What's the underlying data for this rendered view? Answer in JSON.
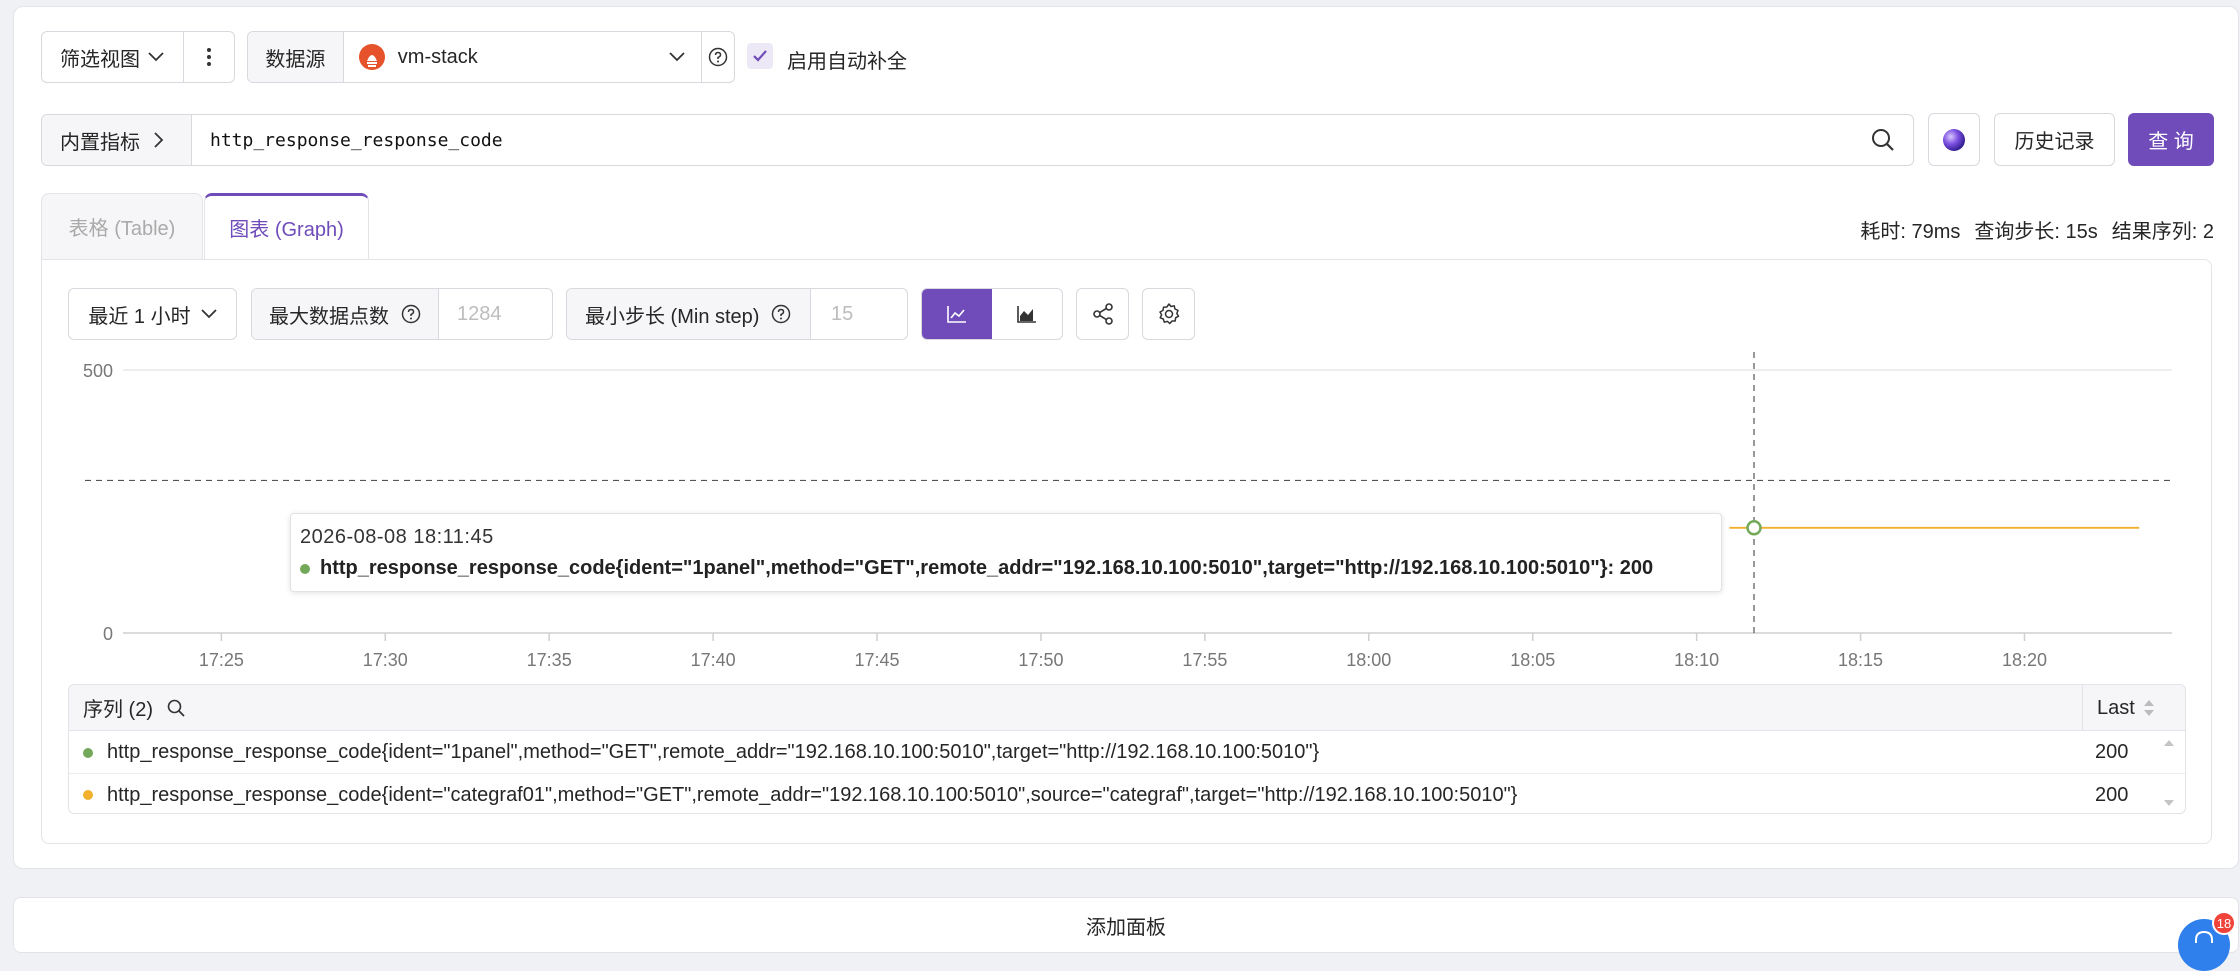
{
  "toolbar": {
    "filter_view_label": "筛选视图",
    "datasource_label": "数据源",
    "datasource_value": "vm-stack",
    "autocomplete_label": "启用自动补全",
    "autocomplete_checked": true
  },
  "query": {
    "builtin_metrics_label": "内置指标",
    "expression": "http_response_response_code",
    "history_label": "历史记录",
    "submit_label": "查 询"
  },
  "tabs": [
    {
      "label": "表格 (Table)",
      "active": false
    },
    {
      "label": "图表 (Graph)",
      "active": true
    }
  ],
  "stats": {
    "duration": "耗时: 79ms",
    "step": "查询步长: 15s",
    "series_count": "结果序列: 2"
  },
  "graph_controls": {
    "time_range": "最近 1 小时",
    "max_points_label": "最大数据点数",
    "max_points_placeholder": "1284",
    "min_step_label": "最小步长 (Min step)",
    "min_step_placeholder": "15"
  },
  "colors": {
    "accent": "#6f4cba",
    "series_green": "#73a85a",
    "series_orange": "#f2b12d"
  },
  "chart_data": {
    "type": "line",
    "x_ticks": [
      "17:25",
      "17:30",
      "17:35",
      "17:40",
      "17:45",
      "17:50",
      "17:55",
      "18:00",
      "18:05",
      "18:10",
      "18:15",
      "18:20"
    ],
    "y_ticks": [
      "0",
      "500"
    ],
    "ylim": [
      0,
      500
    ],
    "threshold": 290,
    "hover_time": "18:11:45",
    "series": [
      {
        "name": "http_response_response_code{ident=\"1panel\",method=\"GET\",remote_addr=\"192.168.10.100:5010\",target=\"http://192.168.10.100:5010\"}",
        "color": "#73a85a",
        "points": [
          [
            "18:11:45",
            200
          ]
        ]
      },
      {
        "name": "http_response_response_code{ident=\"categraf01\",method=\"GET\",remote_addr=\"192.168.10.100:5010\",source=\"categraf\",target=\"http://192.168.10.100:5010\"}",
        "color": "#f2b12d",
        "points": [
          [
            "18:11:00",
            200
          ],
          [
            "18:23:30",
            200
          ]
        ]
      }
    ]
  },
  "tooltip": {
    "time": "2026-08-08 18:11:45",
    "series": "http_response_response_code{ident=\"1panel\",method=\"GET\",remote_addr=\"192.168.10.100:5010\",target=\"http://192.168.10.100:5010\"}: 200"
  },
  "legend": {
    "title": "序列 (2)",
    "last_header": "Last",
    "rows": [
      {
        "name": "http_response_response_code{ident=\"1panel\",method=\"GET\",remote_addr=\"192.168.10.100:5010\",target=\"http://192.168.10.100:5010\"}",
        "last": "200",
        "color": "#73a85a"
      },
      {
        "name": "http_response_response_code{ident=\"categraf01\",method=\"GET\",remote_addr=\"192.168.10.100:5010\",source=\"categraf\",target=\"http://192.168.10.100:5010\"}",
        "last": "200",
        "color": "#f2b12d"
      }
    ]
  },
  "footer": {
    "add_panel_label": "添加面板",
    "notification_count": "18"
  }
}
